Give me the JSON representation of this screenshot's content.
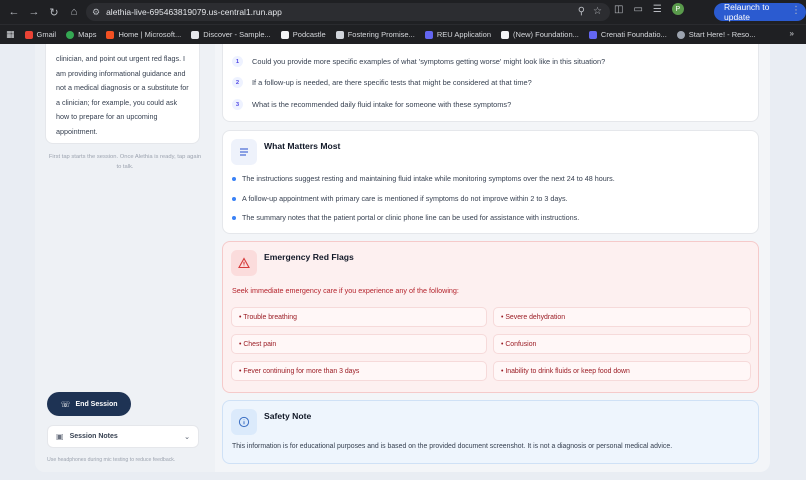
{
  "browser": {
    "url": "alethia-live-695463819079.us-central1.run.app",
    "relaunch_label": "Relaunch to update",
    "avatar_letter": "P",
    "bookmarks": [
      {
        "label": "Gmail",
        "color": "#ea4335"
      },
      {
        "label": "Maps",
        "color": "#34a853"
      },
      {
        "label": "Home | Microsoft...",
        "color": "#f25022"
      },
      {
        "label": "Discover - Sample...",
        "color": "#ffffff"
      },
      {
        "label": "Podcastle",
        "color": "#ffffff"
      },
      {
        "label": "Fostering Promise...",
        "color": "#ffffff"
      },
      {
        "label": "REU Application",
        "color": "#6366f1"
      },
      {
        "label": "(New) Foundation...",
        "color": "#ffffff"
      },
      {
        "label": "Crenati Foundatio...",
        "color": "#6366f1"
      },
      {
        "label": "Start Here! - Reso...",
        "color": "#9ca3af"
      }
    ]
  },
  "sidebar": {
    "intro_lines": [
      "clinician, and point out urgent red flags. I",
      "am providing informational guidance and",
      "not a medical diagnosis or a substitute for",
      "a clinician; for example, you could ask",
      "how to prepare for an upcoming",
      "appointment."
    ],
    "tap_hint": "First tap starts the session. Once Alethia is ready, tap again to talk.",
    "end_session_label": "End Session",
    "session_notes_label": "Session Notes",
    "headphone_hint": "Use headphones during mic testing to reduce feedback."
  },
  "questions": [
    {
      "num": "1",
      "text": "Could you provide more specific examples of what 'symptoms getting worse' might look like in this situation?"
    },
    {
      "num": "2",
      "text": "If a follow-up is needed, are there specific tests that might be considered at that time?"
    },
    {
      "num": "3",
      "text": "What is the recommended daily fluid intake for someone with these symptoms?"
    }
  ],
  "what_matters": {
    "title": "What Matters Most",
    "items": [
      "The instructions suggest resting and maintaining fluid intake while monitoring symptoms over the next 24 to 48 hours.",
      "A follow-up appointment with primary care is mentioned if symptoms do not improve within 2 to 3 days.",
      "The summary notes that the patient portal or clinic phone line can be used for assistance with instructions."
    ]
  },
  "red_flags": {
    "title": "Emergency Red Flags",
    "subtitle": "Seek immediate emergency care if you experience any of the following:",
    "items": [
      "• Trouble breathing",
      "• Severe dehydration",
      "• Chest pain",
      "• Confusion",
      "• Fever continuing for more than 3 days",
      "• Inability to drink fluids or keep food down"
    ]
  },
  "safety": {
    "title": "Safety Note",
    "body": "This information is for educational purposes and is based on the provided document screenshot. It is not a diagnosis or personal medical advice."
  }
}
